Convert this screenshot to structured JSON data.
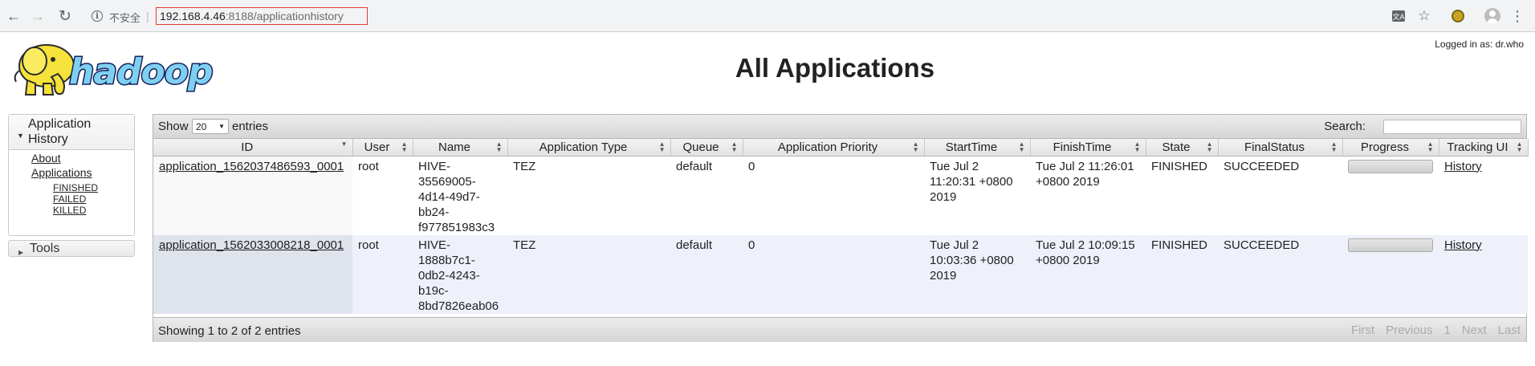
{
  "browser": {
    "insecure_label": "不安全",
    "separator": "|",
    "url_host": "192.168.4.46",
    "url_rest": ":8188/applicationhistory",
    "translate_icon": "translate-icon",
    "star_icon": "bookmark-star-icon",
    "extension_icon": "extension-icon",
    "profile_icon": "profile-avatar-icon"
  },
  "header": {
    "logo_text": "hadoop",
    "logged_in": "Logged in as: dr.who",
    "title": "All Applications"
  },
  "sidebar": {
    "section_title": "Application History",
    "about": "About",
    "applications": "Applications",
    "states": [
      "FINISHED",
      "FAILED",
      "KILLED"
    ],
    "tools": "Tools"
  },
  "table": {
    "show_label": "Show",
    "length_value": "20",
    "entries_label": "entries",
    "search_label": "Search:",
    "columns": [
      "ID",
      "User",
      "Name",
      "Application Type",
      "Queue",
      "Application Priority",
      "StartTime",
      "FinishTime",
      "State",
      "FinalStatus",
      "Progress",
      "Tracking UI"
    ],
    "rows": [
      {
        "id": "application_1562037486593_0001",
        "user": "root",
        "name": "HIVE-35569005-4d14-49d7-bb24-f977851983c3",
        "type": "TEZ",
        "queue": "default",
        "priority": "0",
        "start": "Tue Jul 2 11:20:31 +0800 2019",
        "finish": "Tue Jul 2 11:26:01 +0800 2019",
        "state": "FINISHED",
        "final": "SUCCEEDED",
        "progress": 0,
        "tracking": "History"
      },
      {
        "id": "application_1562033008218_0001",
        "user": "root",
        "name": "HIVE-1888b7c1-0db2-4243-b19c-8bd7826eab06",
        "type": "TEZ",
        "queue": "default",
        "priority": "0",
        "start": "Tue Jul 2 10:03:36 +0800 2019",
        "finish": "Tue Jul 2 10:09:15 +0800 2019",
        "state": "FINISHED",
        "final": "SUCCEEDED",
        "progress": 0,
        "tracking": "History"
      }
    ],
    "info": "Showing 1 to 2 of 2 entries",
    "pager": [
      "First",
      "Previous",
      "1",
      "Next",
      "Last"
    ]
  }
}
